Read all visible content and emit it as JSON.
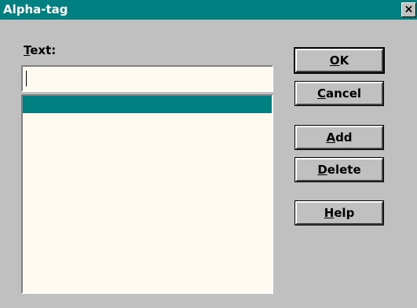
{
  "window": {
    "title": "Alpha-tag",
    "close_glyph": "×"
  },
  "form": {
    "text_label_mnemonic": "T",
    "text_label_rest": "ext:",
    "text_value": ""
  },
  "list": {
    "items": [
      ""
    ],
    "selected_index": 0
  },
  "buttons": {
    "ok": {
      "mnemonic": "O",
      "rest": "K"
    },
    "cancel": {
      "mnemonic": "C",
      "rest": "ancel"
    },
    "add": {
      "mnemonic": "A",
      "rest": "dd"
    },
    "delete": {
      "mnemonic": "D",
      "rest": "elete"
    },
    "help": {
      "mnemonic": "H",
      "rest": "elp"
    }
  },
  "colors": {
    "titlebar": "#008080",
    "selection": "#008080",
    "face": "#c0c0c0",
    "field_bg": "#fffaf0"
  }
}
